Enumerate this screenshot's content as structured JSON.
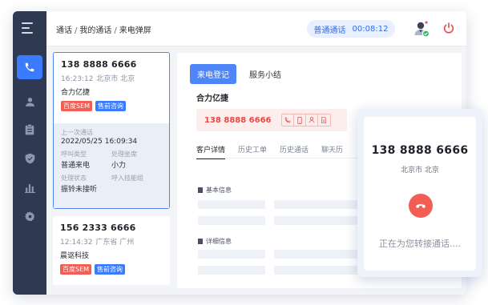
{
  "header": {
    "breadcrumb": [
      "通话",
      "我的通话",
      "来电弹屏"
    ],
    "call_status": "普通通话",
    "call_timer": "00:08:12"
  },
  "sidebar": {
    "items": [
      {
        "icon": "phone-icon",
        "active": true
      },
      {
        "icon": "user-icon",
        "active": false
      },
      {
        "icon": "clipboard-icon",
        "active": false
      },
      {
        "icon": "shield-icon",
        "active": false
      },
      {
        "icon": "bar-chart-icon",
        "active": false
      },
      {
        "icon": "gear-icon",
        "active": false
      }
    ]
  },
  "call_list": [
    {
      "phone": "138 8888 6666",
      "time": "16:23:12",
      "location": "北京市 北京",
      "company": "合力亿捷",
      "tags": [
        {
          "label": "百度SEM",
          "color": "#f25d54"
        },
        {
          "label": "售前咨询",
          "color": "#3b7cff"
        }
      ],
      "last_call_label": "上一次通话",
      "last_call_time": "2022/05/25  16:09:34",
      "call_type_label": "呼叫类型",
      "call_type": "普通来电",
      "agent_label": "处理坐席",
      "agent": "小力",
      "status_label": "处理状态",
      "status": "振铃未接听",
      "transfer_label": "呼入技能组"
    },
    {
      "phone": "156 2333 6666",
      "time": "12:14:32",
      "location": "广东省 广州",
      "company": "晨讴科技",
      "tags": [
        {
          "label": "百度SEM",
          "color": "#f25d54"
        },
        {
          "label": "售前咨询",
          "color": "#3b7cff"
        }
      ]
    }
  ],
  "main": {
    "tabs": [
      "来电登记",
      "服务小结"
    ],
    "company": "合力亿捷",
    "caller_number": "138 8888 6666",
    "subtabs": [
      "客户详情",
      "历史工单",
      "历史通话",
      "聊天历"
    ],
    "sections": [
      "基本信息",
      "详细信息"
    ]
  },
  "incoming": {
    "number": "138 8888 6666",
    "location": "北京市 北京",
    "status": "正在为您转接通话...."
  }
}
